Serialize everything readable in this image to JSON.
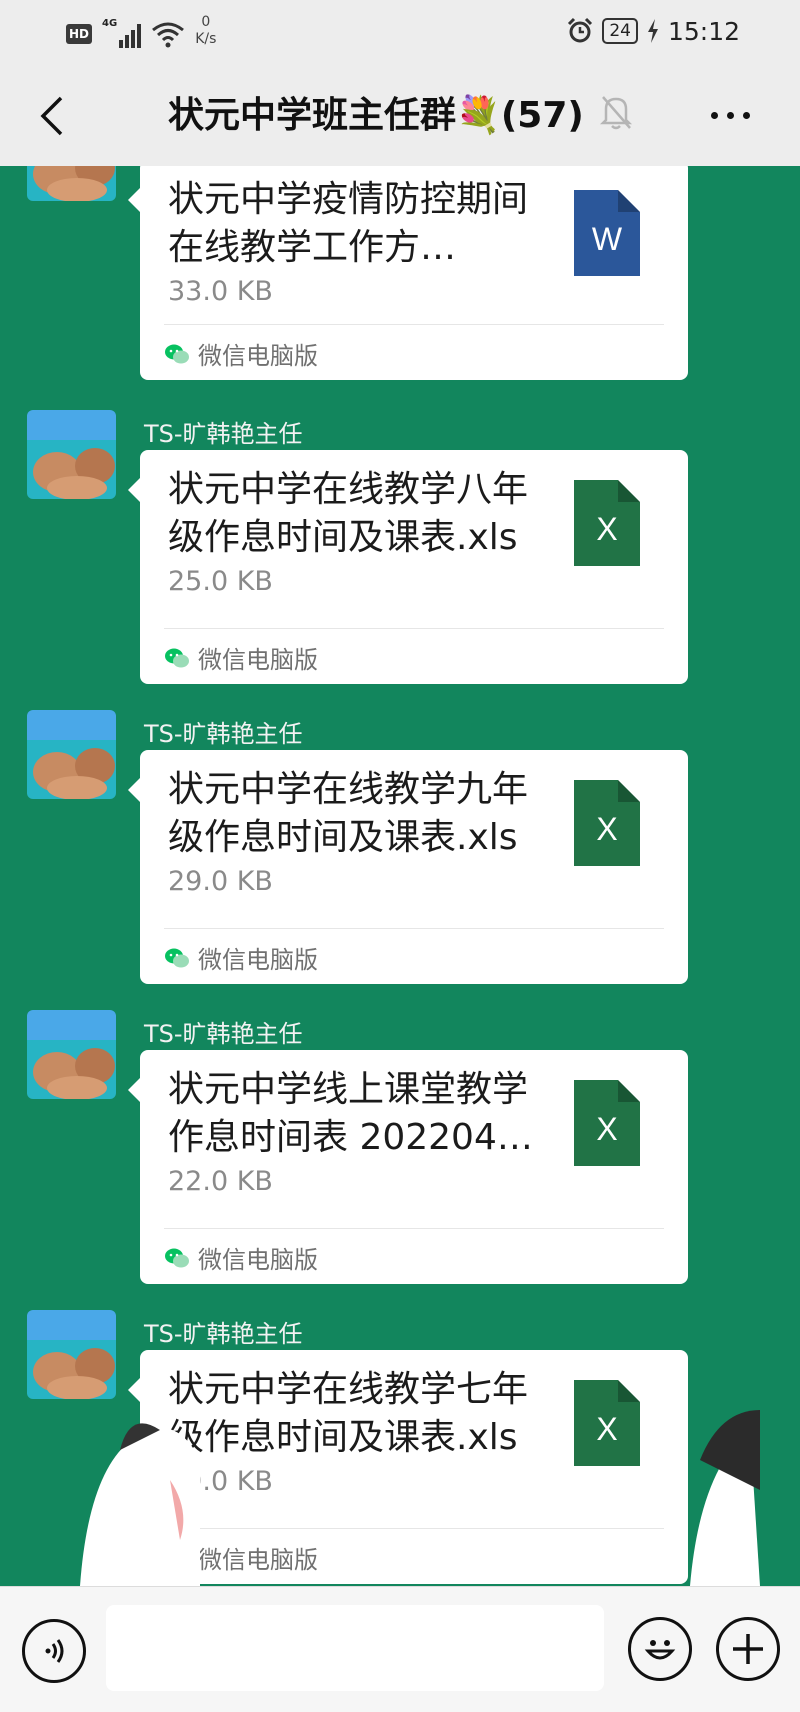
{
  "status_bar": {
    "hd": "HD",
    "network": "4G",
    "speed_value": "0",
    "speed_unit": "K/s",
    "battery": "24",
    "time": "15:12"
  },
  "header": {
    "title": "状元中学班主任群💐(57)",
    "icons": {
      "back": "chevron-left-icon",
      "mute": "bell-muted-icon",
      "more": "ellipsis-icon"
    }
  },
  "messages": [
    {
      "sender": "",
      "file_name": "状元中学疫情防控期间在线教学工作方…",
      "file_size": "33.0 KB",
      "file_type": "W",
      "file_color": "#2b579a",
      "source": "微信电脑版"
    },
    {
      "sender": "TS-旷韩艳主任",
      "file_name": "状元中学在线教学八年级作息时间及课表.xls",
      "file_size": "25.0 KB",
      "file_type": "X",
      "file_color": "#217346",
      "source": "微信电脑版"
    },
    {
      "sender": "TS-旷韩艳主任",
      "file_name": "状元中学在线教学九年级作息时间及课表.xls",
      "file_size": "29.0 KB",
      "file_type": "X",
      "file_color": "#217346",
      "source": "微信电脑版"
    },
    {
      "sender": "TS-旷韩艳主任",
      "file_name": "状元中学线上课堂教学作息时间表 202204…",
      "file_size": "22.0 KB",
      "file_type": "X",
      "file_color": "#217346",
      "source": "微信电脑版"
    },
    {
      "sender": "TS-旷韩艳主任",
      "file_name": "状元中学在线教学七年级作息时间及课表.xls",
      "file_size": "29.0 KB",
      "file_type": "X",
      "file_color": "#217346",
      "source": "微信电脑版"
    }
  ],
  "bottom_bar": {
    "input_value": "",
    "icons": {
      "voice": "voice-icon",
      "emoji": "emoji-icon",
      "add": "plus-icon"
    }
  },
  "colors": {
    "chat_background": "#12865d",
    "header_background": "#ededed",
    "wechat_green": "#07c160"
  }
}
